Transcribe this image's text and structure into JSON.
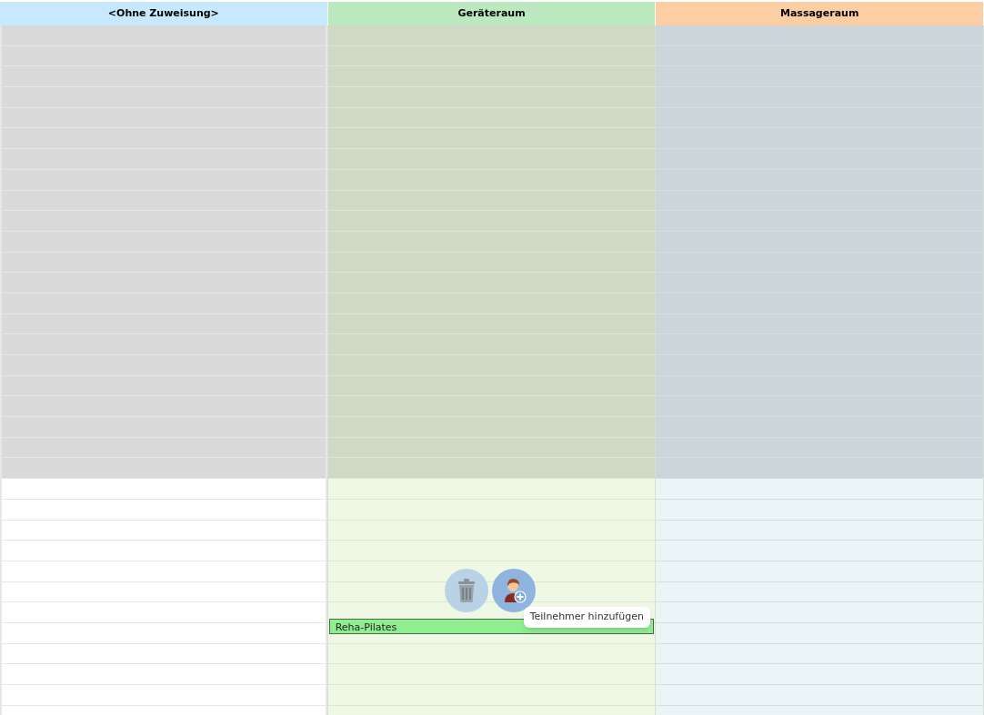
{
  "columns": [
    {
      "title": "<Ohne Zuweisung>",
      "color": "#c7e8fd"
    },
    {
      "title": "Geräteraum",
      "color": "#bbe8bf",
      "appointments": [
        {
          "title": "Reha-Pilates"
        }
      ]
    },
    {
      "title": "Massageraum",
      "color": "#fdcda4"
    }
  ],
  "actions": [
    {
      "kind": "delete",
      "selected": false
    },
    {
      "kind": "add-participant",
      "selected": true
    }
  ],
  "tooltip": "Teilnehmer hinzufügen"
}
